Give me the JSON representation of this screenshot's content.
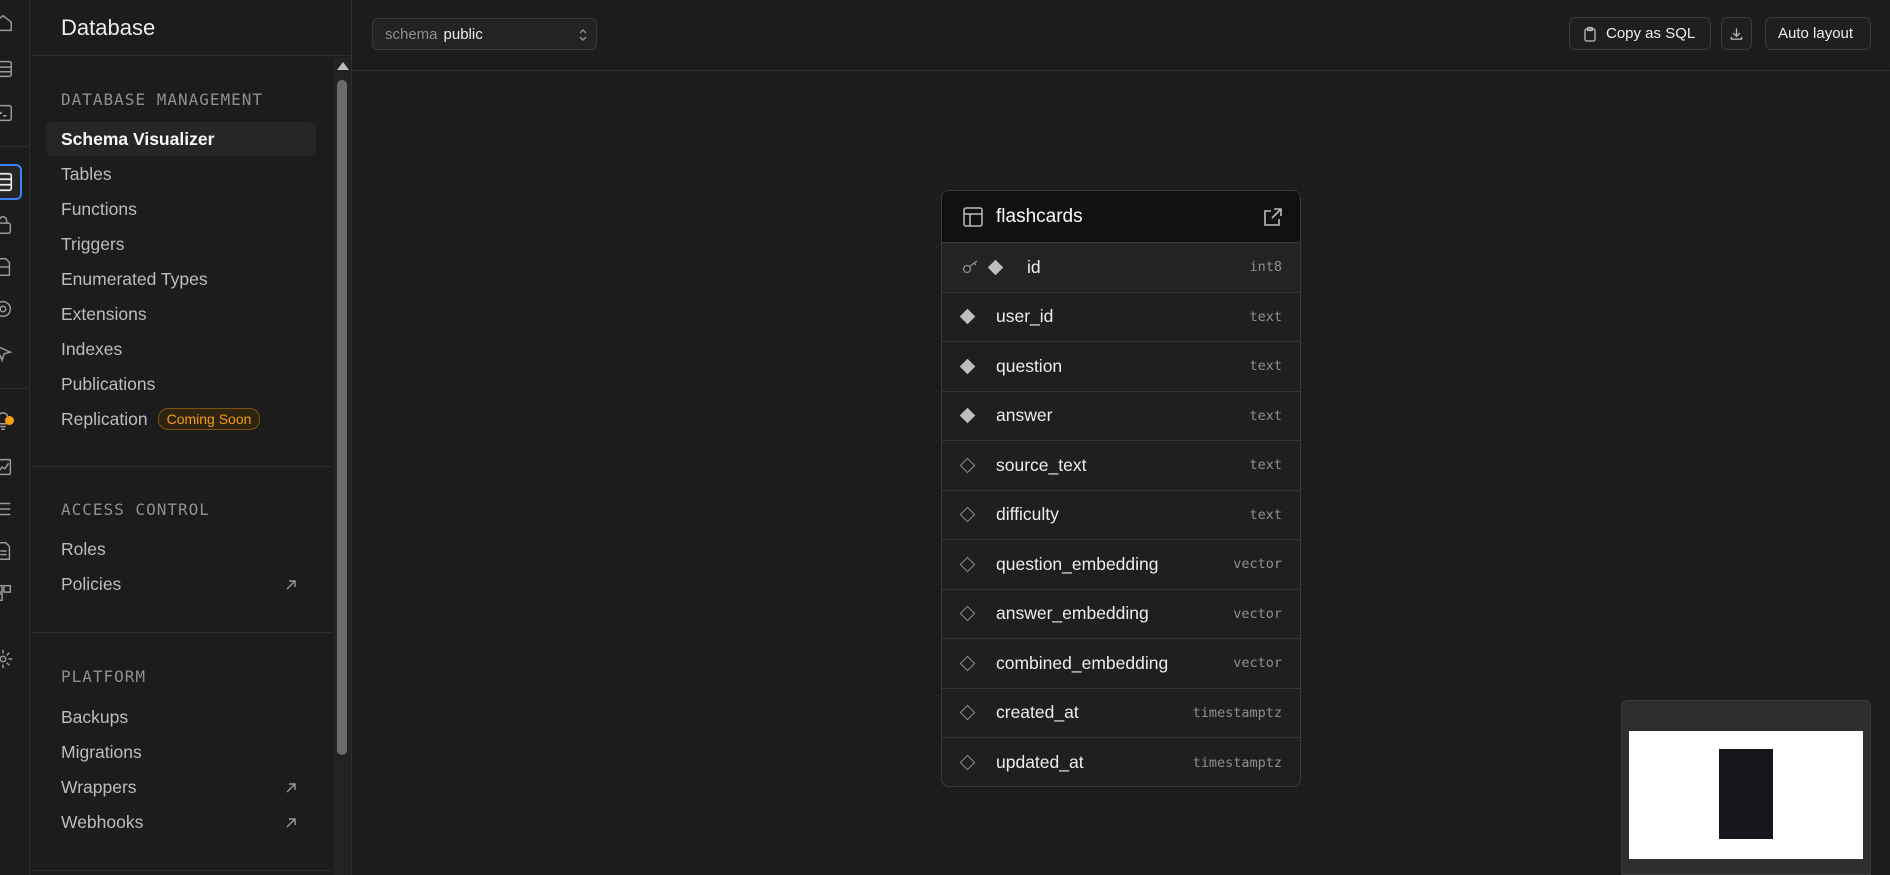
{
  "sidebar": {
    "title": "Database",
    "sections": [
      {
        "title": "DATABASE MANAGEMENT",
        "items": [
          {
            "label": "Schema Visualizer"
          },
          {
            "label": "Tables"
          },
          {
            "label": "Functions"
          },
          {
            "label": "Triggers"
          },
          {
            "label": "Enumerated Types"
          },
          {
            "label": "Extensions"
          },
          {
            "label": "Indexes"
          },
          {
            "label": "Publications"
          },
          {
            "label": "Replication",
            "badge": "Coming Soon"
          }
        ]
      },
      {
        "title": "ACCESS CONTROL",
        "items": [
          {
            "label": "Roles"
          },
          {
            "label": "Policies"
          }
        ]
      },
      {
        "title": "PLATFORM",
        "items": [
          {
            "label": "Backups"
          },
          {
            "label": "Migrations"
          },
          {
            "label": "Wrappers"
          },
          {
            "label": "Webhooks"
          }
        ]
      }
    ]
  },
  "toolbar": {
    "schema_label": "schema",
    "schema_value": "public",
    "copy_sql_label": "Copy as SQL",
    "auto_layout_label": "Auto layout"
  },
  "table": {
    "name": "flashcards",
    "columns": [
      {
        "name": "id",
        "type": "int8",
        "primary_key": true,
        "nullable": false
      },
      {
        "name": "user_id",
        "type": "text",
        "nullable": false
      },
      {
        "name": "question",
        "type": "text",
        "nullable": false
      },
      {
        "name": "answer",
        "type": "text",
        "nullable": false
      },
      {
        "name": "source_text",
        "type": "text",
        "nullable": true
      },
      {
        "name": "difficulty",
        "type": "text",
        "nullable": true
      },
      {
        "name": "question_embedding",
        "type": "vector",
        "nullable": true
      },
      {
        "name": "answer_embedding",
        "type": "vector",
        "nullable": true
      },
      {
        "name": "combined_embedding",
        "type": "vector",
        "nullable": true
      },
      {
        "name": "created_at",
        "type": "timestamptz",
        "nullable": true
      },
      {
        "name": "updated_at",
        "type": "timestamptz",
        "nullable": true
      }
    ]
  },
  "colors": {
    "background": "#1c1c1c",
    "active_ring": "#3b82f6",
    "badge": "#f59e0b"
  },
  "icons": [
    "home-icon",
    "table-editor-icon",
    "sql-editor-icon",
    "database-icon",
    "auth-icon",
    "storage-icon",
    "realtime-icon",
    "edge-functions-icon",
    "advisors-icon",
    "reports-icon",
    "logs-icon",
    "api-docs-icon",
    "integrations-icon",
    "settings-icon",
    "table-icon",
    "open-external-icon",
    "key-icon",
    "clipboard-icon",
    "download-icon"
  ]
}
